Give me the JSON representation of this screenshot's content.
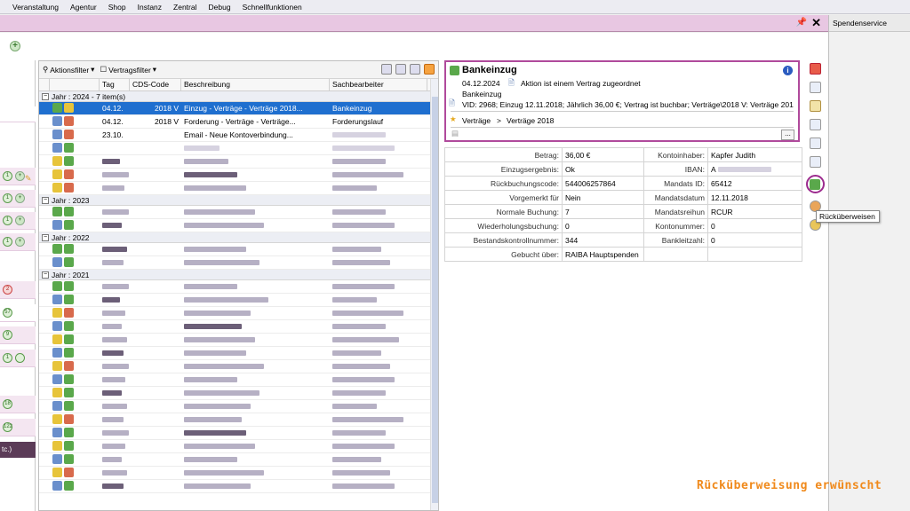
{
  "menu": [
    "Veranstaltung",
    "Agentur",
    "Shop",
    "Instanz",
    "Zentral",
    "Debug",
    "Schnellfunktionen"
  ],
  "side_panel_title": "Spendenservice",
  "toolbar": {
    "actions_filter": "Aktionsfilter",
    "contract_filter": "Vertragsfilter"
  },
  "columns": [
    "Tag",
    "CDS-Code",
    "Beschreibung",
    "Sachbearbeiter"
  ],
  "groups": [
    {
      "label": "Jahr : 2024 - 7 item(s)"
    },
    {
      "label": "Jahr : 2023"
    },
    {
      "label": "Jahr : 2022"
    },
    {
      "label": "Jahr : 2021"
    }
  ],
  "rows": [
    {
      "tag": "04.12.",
      "cds": "2018 V",
      "desc": "Einzug - Verträge - Verträge 2018...",
      "agent": "Bankeinzug"
    },
    {
      "tag": "04.12.",
      "cds": "2018 V",
      "desc": "Forderung  - Verträge - Verträge...",
      "agent": "Forderungslauf"
    },
    {
      "tag": "23.10.",
      "cds": "",
      "desc": "Email - Neue Kontoverbindung...",
      "agent": ""
    }
  ],
  "left_badges": [
    "1",
    "1",
    "1",
    "1",
    "2",
    "57",
    "9",
    "1",
    "18",
    "122"
  ],
  "left_dark_label": "tc.)",
  "detail": {
    "title": "Bankeinzug",
    "date": "04.12.2024",
    "contract_note": "Aktion ist einem Vertrag zugeordnet",
    "subtitle": "Bankeinzug",
    "contract_line": "VID: 2968; Einzug 12.11.2018; Jährlich 36,00 €; Vertrag ist buchbar; Verträge\\2018 V: Verträge 201",
    "path_a": "Verträge",
    "path_sep": ">",
    "path_b": "Verträge 2018",
    "dots": "..."
  },
  "props": [
    {
      "k1": "Betrag:",
      "v1": "36,00 €",
      "k2": "Kontoinhaber:",
      "v2": "Kapfer Judith"
    },
    {
      "k1": "Einzugsergebnis:",
      "v1": "Ok",
      "k2": "IBAN:",
      "v2": "A"
    },
    {
      "k1": "Rückbuchungscode:",
      "v1": "544006257864",
      "k2": "Mandats ID:",
      "v2": "65412"
    },
    {
      "k1": "Vorgemerkt für",
      "v1": "Nein",
      "k2": "Mandatsdatum",
      "v2": "12.11.2018"
    },
    {
      "k1": "Normale Buchung:",
      "v1": "7",
      "k2": "Mandatsreihun",
      "v2": "RCUR"
    },
    {
      "k1": "Wiederholungsbuchung:",
      "v1": "0",
      "k2": "Kontonummer:",
      "v2": "0"
    },
    {
      "k1": "Bestandskontrollnummer:",
      "v1": "344",
      "k2": "Bankleitzahl:",
      "v2": "0"
    },
    {
      "k1": "Gebucht über:",
      "v1": "RAIBA Hauptspenden",
      "k2": "",
      "v2": ""
    }
  ],
  "tooltip": "Rücküberweisen",
  "caption": "Rücküberweisung erwünscht",
  "colors": {
    "accent": "#9c2b8e",
    "selection": "#1f6fcf",
    "caption": "#f08a1c"
  }
}
